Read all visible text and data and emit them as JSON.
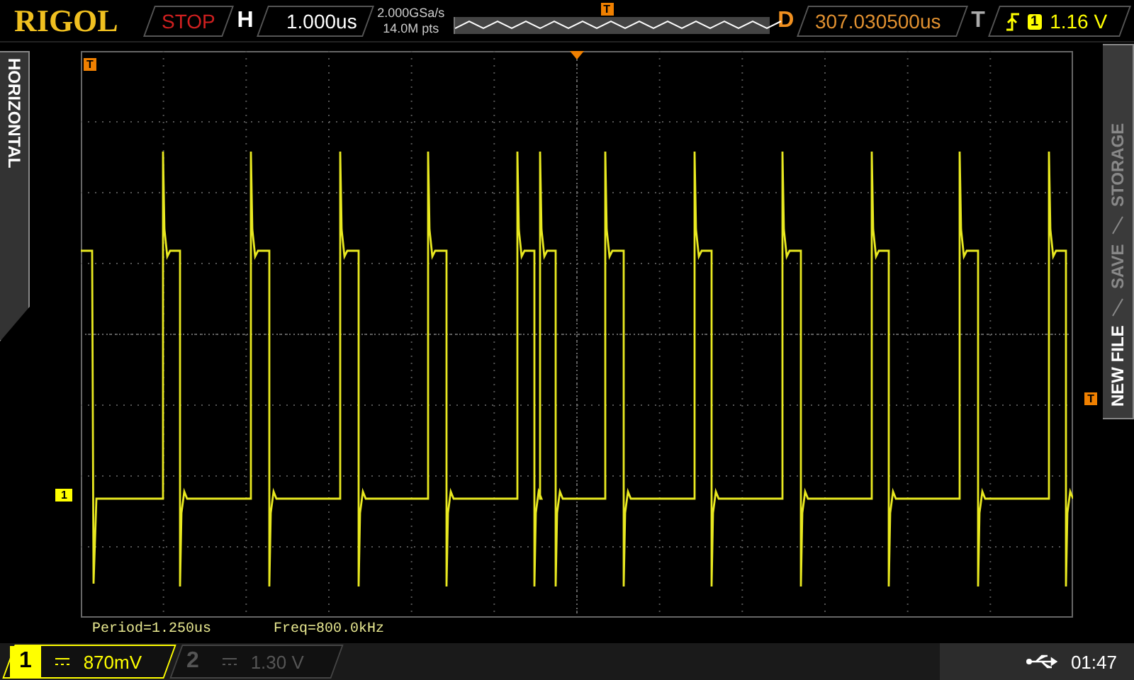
{
  "header": {
    "brand": "RIGOL",
    "run_state": "STOP",
    "timebase_label": "H",
    "timebase": "1.000us",
    "sample_rate": "2.000GSa/s",
    "memory_depth": "14.0M pts",
    "delay_label": "D",
    "delay": "307.030500us",
    "trigger_label": "T",
    "trigger_channel": "1",
    "trigger_level": "1.16 V"
  },
  "markers": {
    "trigger_position": "T",
    "trigger_left": "T",
    "trigger_level": "T",
    "channel": "1"
  },
  "side_tab": {
    "label": "HORIZONTAL"
  },
  "menu": {
    "items": [
      "STORAGE",
      "SAVE",
      "NEW FILE"
    ]
  },
  "measurements": [
    "Period=1.250us",
    "Freq=800.0kHz"
  ],
  "channels": [
    {
      "number": "1",
      "scale": "870mV",
      "on": true
    },
    {
      "number": "2",
      "scale": "1.30 V",
      "on": false
    }
  ],
  "status": {
    "time": "01:47"
  }
}
